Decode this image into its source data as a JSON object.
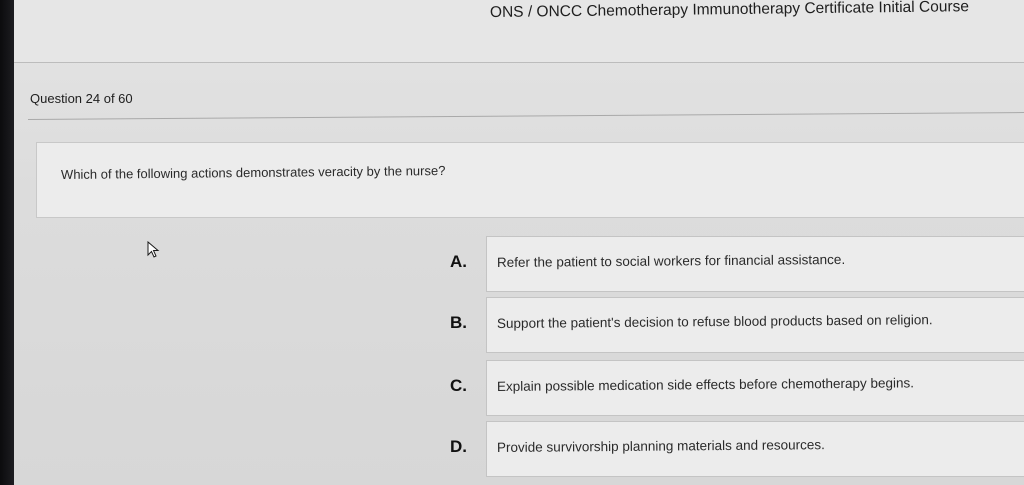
{
  "header": {
    "course_title": "ONS / ONCC Chemotherapy Immunotherapy Certificate Initial Course"
  },
  "progress": {
    "counter": "Question 24 of 60"
  },
  "question": {
    "text": "Which of the following actions demonstrates veracity by the nurse?"
  },
  "options": [
    {
      "letter": "A.",
      "text": "Refer the patient to social workers for financial assistance."
    },
    {
      "letter": "B.",
      "text": "Support the patient's decision to refuse blood products based on religion."
    },
    {
      "letter": "C.",
      "text": "Explain possible medication side effects before chemotherapy begins."
    },
    {
      "letter": "D.",
      "text": "Provide survivorship planning materials and resources."
    }
  ],
  "colors": {
    "background": "#dedede",
    "panel": "#ececec",
    "text": "#2a2a2a",
    "bezel": "#141417"
  }
}
